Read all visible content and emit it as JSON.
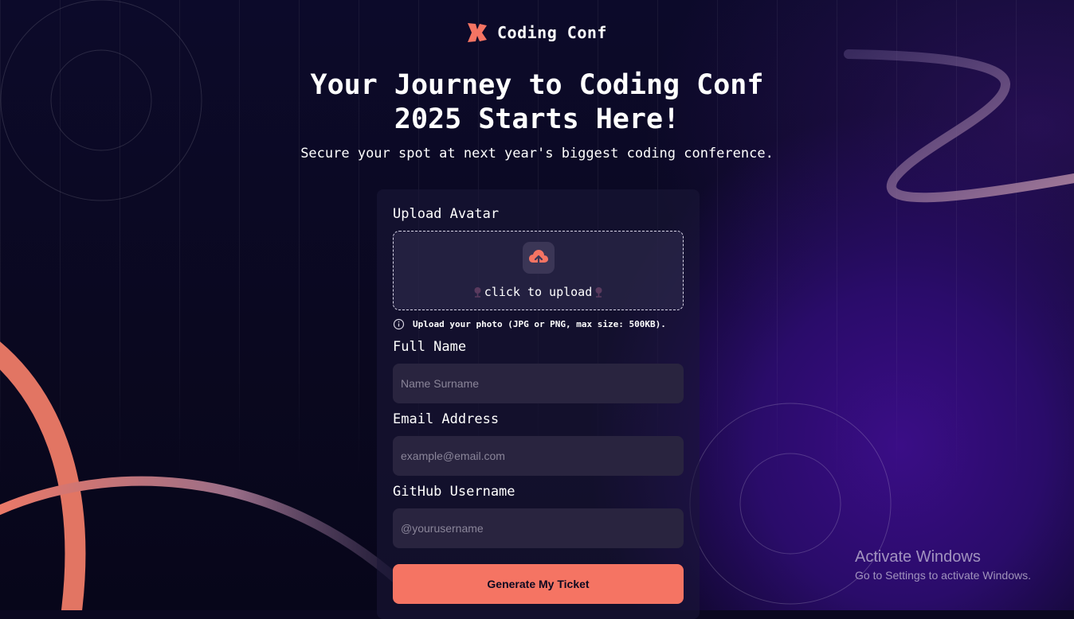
{
  "app": {
    "name": "Coding Conf"
  },
  "hero": {
    "title": "Your Journey to Coding Conf 2025 Starts Here!",
    "subtitle": "Secure your spot at next year's biggest coding conference."
  },
  "form": {
    "avatar_label": "Upload Avatar",
    "upload_text": "click to upload",
    "hint": "Upload your photo (JPG or PNG, max size: 500KB).",
    "full_name_label": "Full Name",
    "full_name_placeholder": "Name Surname",
    "email_label": "Email Address",
    "email_placeholder": "example@email.com",
    "github_label": "GitHub Username",
    "github_placeholder": "@yourusername",
    "submit_label": "Generate My Ticket"
  },
  "system": {
    "activate_title": "Activate Windows",
    "activate_sub": "Go to Settings to activate Windows."
  },
  "icons": [
    "logo-icon",
    "cloud-upload-icon",
    "info-icon",
    "pin-icon"
  ],
  "colors": {
    "accent": "#f57463",
    "background": "#0b0820",
    "field": "#29243f"
  }
}
